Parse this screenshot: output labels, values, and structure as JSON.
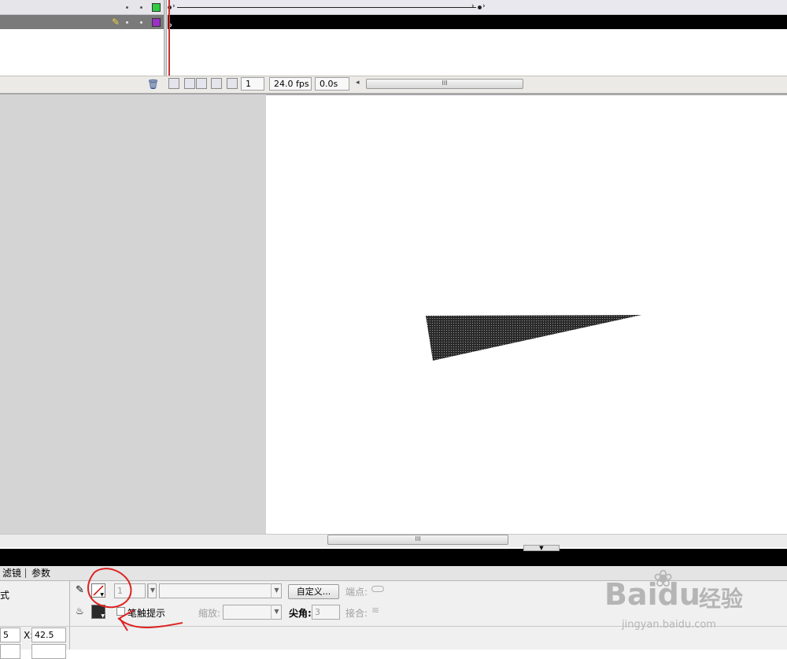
{
  "timeline": {
    "current_frame": "1",
    "frame_rate": "24.0 fps",
    "elapsed_time": "0.0s",
    "scroll_grip": "III",
    "scroll_left_arrow": "◂",
    "layer1_color": "#2ecc40",
    "layer2_color": "#9b30c8"
  },
  "stage": {
    "scroll_grip": "III",
    "collapse_arrow": "▼",
    "shape_fill": "#222222"
  },
  "properties": {
    "tabs": [
      "滤镜",
      "参数"
    ],
    "left_fragment": "式",
    "stroke_height": "1",
    "custom_button": "自定义...",
    "cap_label": "端点:",
    "stroke_hinting": "笔触提示",
    "scale_label": "缩放:",
    "miter_label": "尖角:",
    "miter_value": "3",
    "join_label": "接合:",
    "w_value": "5",
    "x_label": "X:",
    "x_value": "42.5"
  },
  "annotation": {
    "color": "#dd2222"
  },
  "watermark": {
    "brand": "Baidu",
    "suffix": "经验",
    "url": "jingyan.baidu.com"
  }
}
